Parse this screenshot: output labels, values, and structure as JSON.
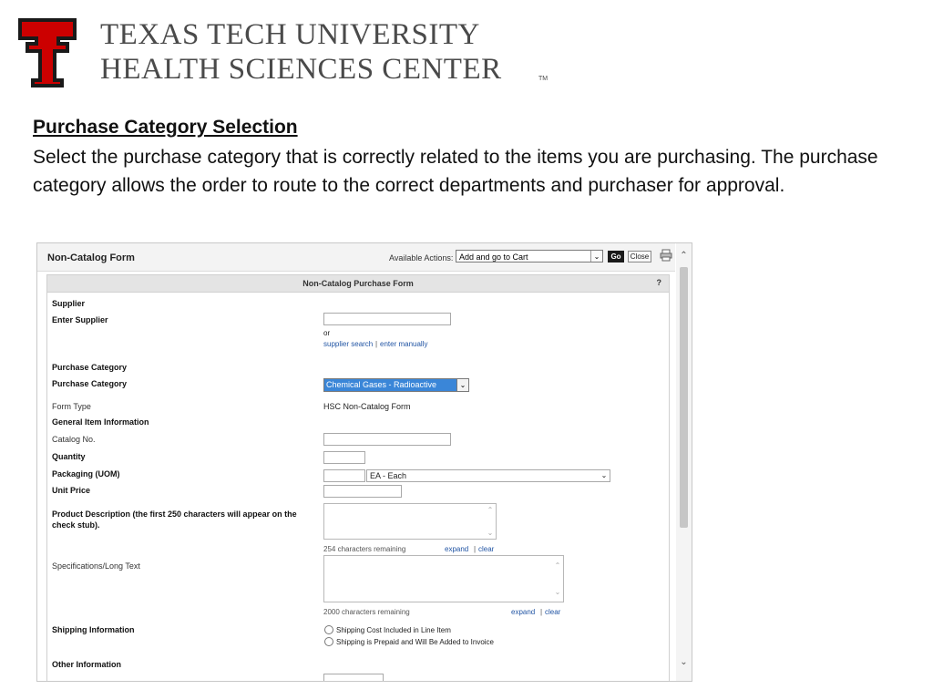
{
  "header": {
    "org_line1": "TEXAS TECH UNIVERSITY",
    "org_line2": "HEALTH SCIENCES CENTER",
    "trademark": "TM",
    "logo_icon": "double-t-logo",
    "brand_color": "#cc0000"
  },
  "slide": {
    "heading": "Purchase Category Selection",
    "body": "Select the purchase category that is correctly related to the items you are purchasing. The purchase category allows the order to route to the correct departments and purchaser for approval."
  },
  "screenshot": {
    "form_title": "Non-Catalog Form",
    "available_actions_label": "Available Actions:",
    "available_actions_value": "Add and go to Cart",
    "go_label": "Go",
    "close_label": "Close",
    "print_icon": "printer-icon",
    "panel_title": "Non-Catalog Purchase Form",
    "help_label": "?",
    "supplier_section": "Supplier",
    "enter_supplier_label": "Enter Supplier",
    "or_label": "or",
    "supplier_search_link": "supplier search",
    "link_separator": "|",
    "enter_manually_link": "enter manually",
    "purchase_category_section": "Purchase Category",
    "purchase_category_label": "Purchase Category",
    "purchase_category_value": "Chemical Gases - Radioactive",
    "form_type_label": "Form Type",
    "form_type_value": "HSC Non-Catalog Form",
    "general_section": "General Item Information",
    "catalog_no_label": "Catalog No.",
    "quantity_label": "Quantity",
    "packaging_label": "Packaging (UOM)",
    "packaging_value": "EA - Each",
    "unit_price_label": "Unit Price",
    "product_description_label": "Product Description (the first 250 characters will appear on the check stub).",
    "description_remaining": "254 characters remaining",
    "expand_link": "expand",
    "clear_link": "clear",
    "specifications_label": "Specifications/Long Text",
    "specifications_remaining": "2000 characters remaining",
    "shipping_label": "Shipping Information",
    "shipping_option1": "Shipping Cost Included in Line Item",
    "shipping_option2": "Shipping is Prepaid and Will Be Added to Invoice",
    "other_section": "Other Information",
    "selection_color": "#3a86d8"
  }
}
